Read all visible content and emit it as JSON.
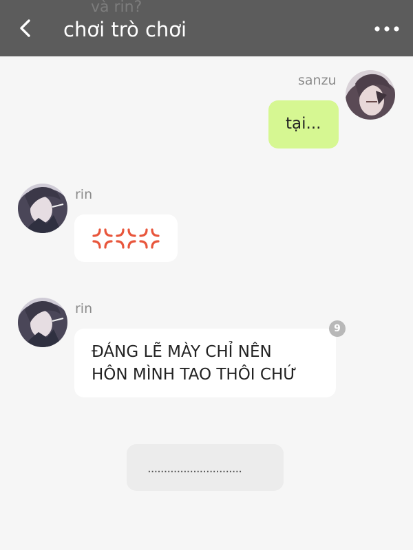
{
  "header": {
    "prev_message_peek": "và rin?",
    "title": "chơi trò chơi",
    "back_icon": "chevron-left-icon",
    "more_icon": "more-horizontal-icon",
    "background": "#5c5c5c"
  },
  "messages": [
    {
      "sender": "sanzu",
      "side": "right",
      "text": "tại...",
      "bubble_color": "#d6f792"
    },
    {
      "sender": "rin",
      "side": "left",
      "text": "💢💢💢",
      "bubble_color": "#ffffff"
    },
    {
      "sender": "rin",
      "side": "left",
      "lines": [
        "ĐÁNG LẼ MÀY CHỈ NÊN",
        "HÔN MÌNH TAO THÔI CHỨ"
      ],
      "badge": "9",
      "bubble_color": "#ffffff"
    }
  ],
  "composer": {
    "text": "............................."
  },
  "colors": {
    "page_background": "#f6f6f6",
    "anger_symbol": "#e8563c"
  }
}
